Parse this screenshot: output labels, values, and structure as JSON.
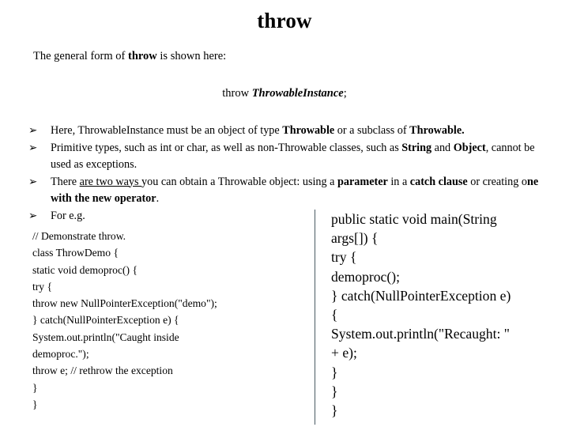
{
  "slide": {
    "title": "throw",
    "intro": {
      "before": "The general form of ",
      "keyword": "throw",
      "after": " is shown here:"
    },
    "syntax": {
      "keyword": "throw",
      "operand": "ThrowableInstance",
      "terminator": ";"
    },
    "bullet_marker": "➢",
    "bullets": [
      {
        "segments": [
          {
            "text": "Here, ThrowableInstance must be an object of type ",
            "style": "normal"
          },
          {
            "text": "Throwable",
            "style": "bold"
          },
          {
            "text": " or a subclass of ",
            "style": "normal"
          },
          {
            "text": "Throwable.",
            "style": "bold"
          }
        ]
      },
      {
        "segments": [
          {
            "text": "Primitive types, such as int or char, as well as non-Throwable classes, such as ",
            "style": "normal"
          },
          {
            "text": "String",
            "style": "bold"
          },
          {
            "text": " and ",
            "style": "normal"
          },
          {
            "text": "Object",
            "style": "bold"
          },
          {
            "text": ", cannot be used as exceptions.",
            "style": "normal"
          }
        ]
      },
      {
        "segments": [
          {
            "text": " There ",
            "style": "normal"
          },
          {
            "text": "are two ways ",
            "style": "underline"
          },
          {
            "text": "you can obtain a Throwable object: using a ",
            "style": "normal"
          },
          {
            "text": "parameter",
            "style": "bold"
          },
          {
            "text": " in a ",
            "style": "normal"
          },
          {
            "text": "catch clause",
            "style": "bold"
          },
          {
            "text": " or creating o",
            "style": "normal"
          },
          {
            "text": "ne with the new operator",
            "style": "bold"
          },
          {
            "text": ".",
            "style": "normal"
          }
        ]
      },
      {
        "segments": [
          {
            "text": " For e.g.",
            "style": "normal"
          }
        ]
      }
    ],
    "code_left": [
      "// Demonstrate throw.",
      "class ThrowDemo {",
      "static void demoproc() {",
      "try {",
      "throw new NullPointerException(\"demo\");",
      "} catch(NullPointerException e) {",
      "System.out.println(\"Caught inside",
      "demoproc.\");",
      "throw e; // rethrow the exception",
      "}",
      "}"
    ],
    "code_right": [
      "public static void main(String",
      "args[]) {",
      "try {",
      "demoproc();",
      "} catch(NullPointerException e)",
      "{",
      "System.out.println(\"Recaught: \"",
      "+ e);",
      "}",
      "}",
      "}"
    ],
    "colors": {
      "background": "#ffffff",
      "text": "#000000",
      "divider": "#4a5a63"
    }
  }
}
